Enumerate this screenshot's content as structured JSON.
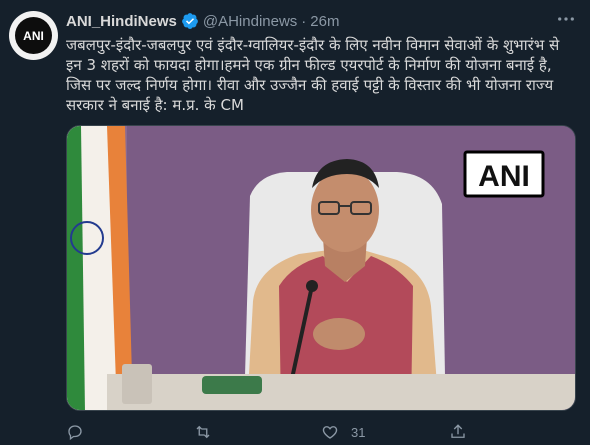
{
  "tweet": {
    "author_name": "ANI_HindiNews",
    "handle": "@AHindinews",
    "separator": "·",
    "time": "26m",
    "avatar_text": "ANI",
    "text": "जबलपुर-इंदौर-जबलपुर एवं इंदौर-ग्वालियर-इंदौर के लिए नवीन विमान सेवाओं के शुभारंभ से इन 3 शहरों को फायदा होगा।हमने एक ग्रीन फील्ड एयरपोर्ट के निर्माण की योजना बनाई है, जिस पर जल्द निर्णय होगा। रीवा और उज्जैन की हवाई पट्टी के विस्तार की भी योजना राज्य सरकार ने बनाई है: म.प्र. के CM",
    "media_watermark": "ANI"
  },
  "actions": {
    "reply_count": "",
    "retweet_count": "",
    "like_count": "31",
    "share_count": ""
  },
  "icons": {
    "more": "more-icon",
    "verified": "verified-badge-icon",
    "reply": "reply-icon",
    "retweet": "retweet-icon",
    "like": "like-icon",
    "share": "share-icon"
  },
  "colors": {
    "background": "#15202b",
    "verified": "#1d9bf0",
    "muted": "#8b98a5"
  }
}
